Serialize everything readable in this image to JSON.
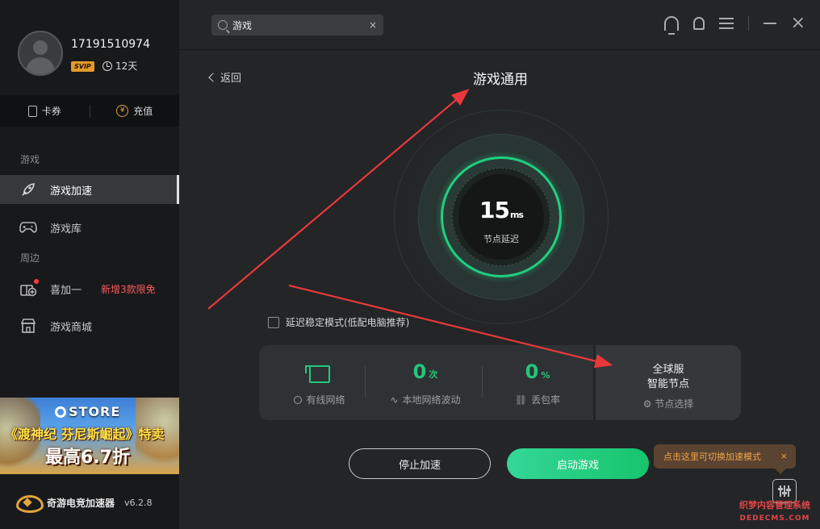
{
  "sidebar": {
    "user": {
      "name": "17191510974",
      "badge": "SVIP",
      "days": "12天"
    },
    "quick": {
      "coupon": "卡券",
      "recharge": "充值",
      "coin_glyph": "¥"
    },
    "section_games": "游戏",
    "section_around": "周边",
    "nav": [
      {
        "label": "游戏加速",
        "icon": "rocket-icon"
      },
      {
        "label": "游戏库",
        "icon": "gamepad-icon"
      },
      {
        "label": "喜加一",
        "icon": "gift-plus-icon",
        "promo": "新增3款限免"
      },
      {
        "label": "游戏商城",
        "icon": "store-icon"
      }
    ],
    "banner": {
      "store": "STORE",
      "line1": "《渡神纪 芬尼斯崛起》特卖",
      "line2": "最高6.7折"
    },
    "brand": {
      "name": "奇游电竞加速器",
      "version": "v6.2.8"
    }
  },
  "search": {
    "value": "游戏",
    "clear": "×"
  },
  "header": {
    "back": "返回",
    "title": "游戏通用"
  },
  "gauge": {
    "value": "15",
    "unit": "ms",
    "label": "节点延迟"
  },
  "checkbox": {
    "label": "延迟稳定模式(低配电脑推荐)"
  },
  "stats": {
    "network": {
      "label": "有线网络"
    },
    "fluct": {
      "value": "0",
      "unit": "次",
      "label": "本地网络波动"
    },
    "loss": {
      "value": "0",
      "unit": "%",
      "label": "丢包率"
    },
    "node": {
      "line1": "全球服",
      "line2": "智能节点",
      "select": "节点选择"
    }
  },
  "buttons": {
    "stop": "停止加速",
    "start": "启动游戏"
  },
  "tip": {
    "text": "点击这里可切换加速模式",
    "close": "×"
  },
  "watermark": {
    "line1": "织梦内容管理系统",
    "line2": "DEDECMS.COM"
  },
  "colors": {
    "accent": "#1ed07f",
    "svip": "#e39a2b",
    "annotation": "#e8383b",
    "tip_text": "#f0a44a"
  }
}
